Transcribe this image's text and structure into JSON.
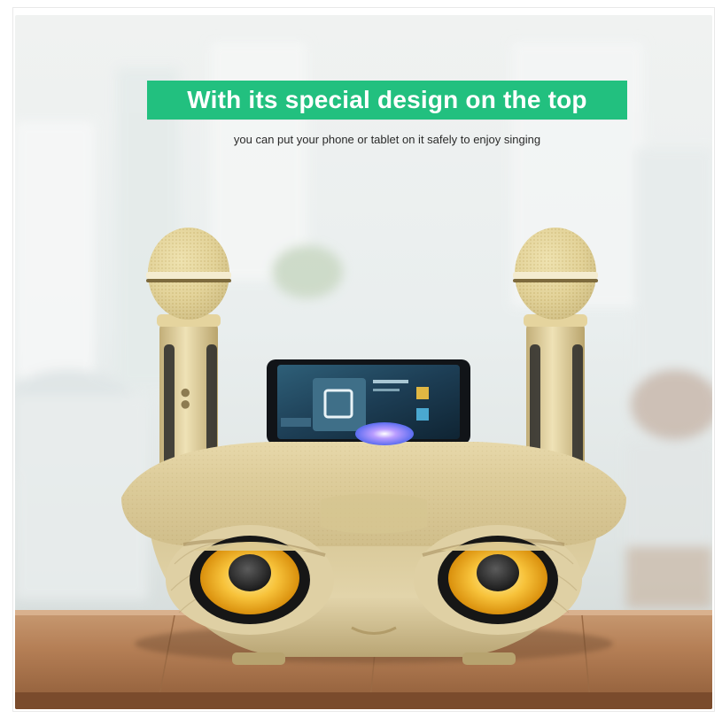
{
  "banner": {
    "headline": "With its special design on the top",
    "subline": "you can put your phone or tablet on it safely to enjoy singing"
  },
  "colors": {
    "banner_green": "#22c07f",
    "product_gold": "#dcc995",
    "speaker_yellow": "#f5b51e",
    "table_wood": "#b98356"
  }
}
